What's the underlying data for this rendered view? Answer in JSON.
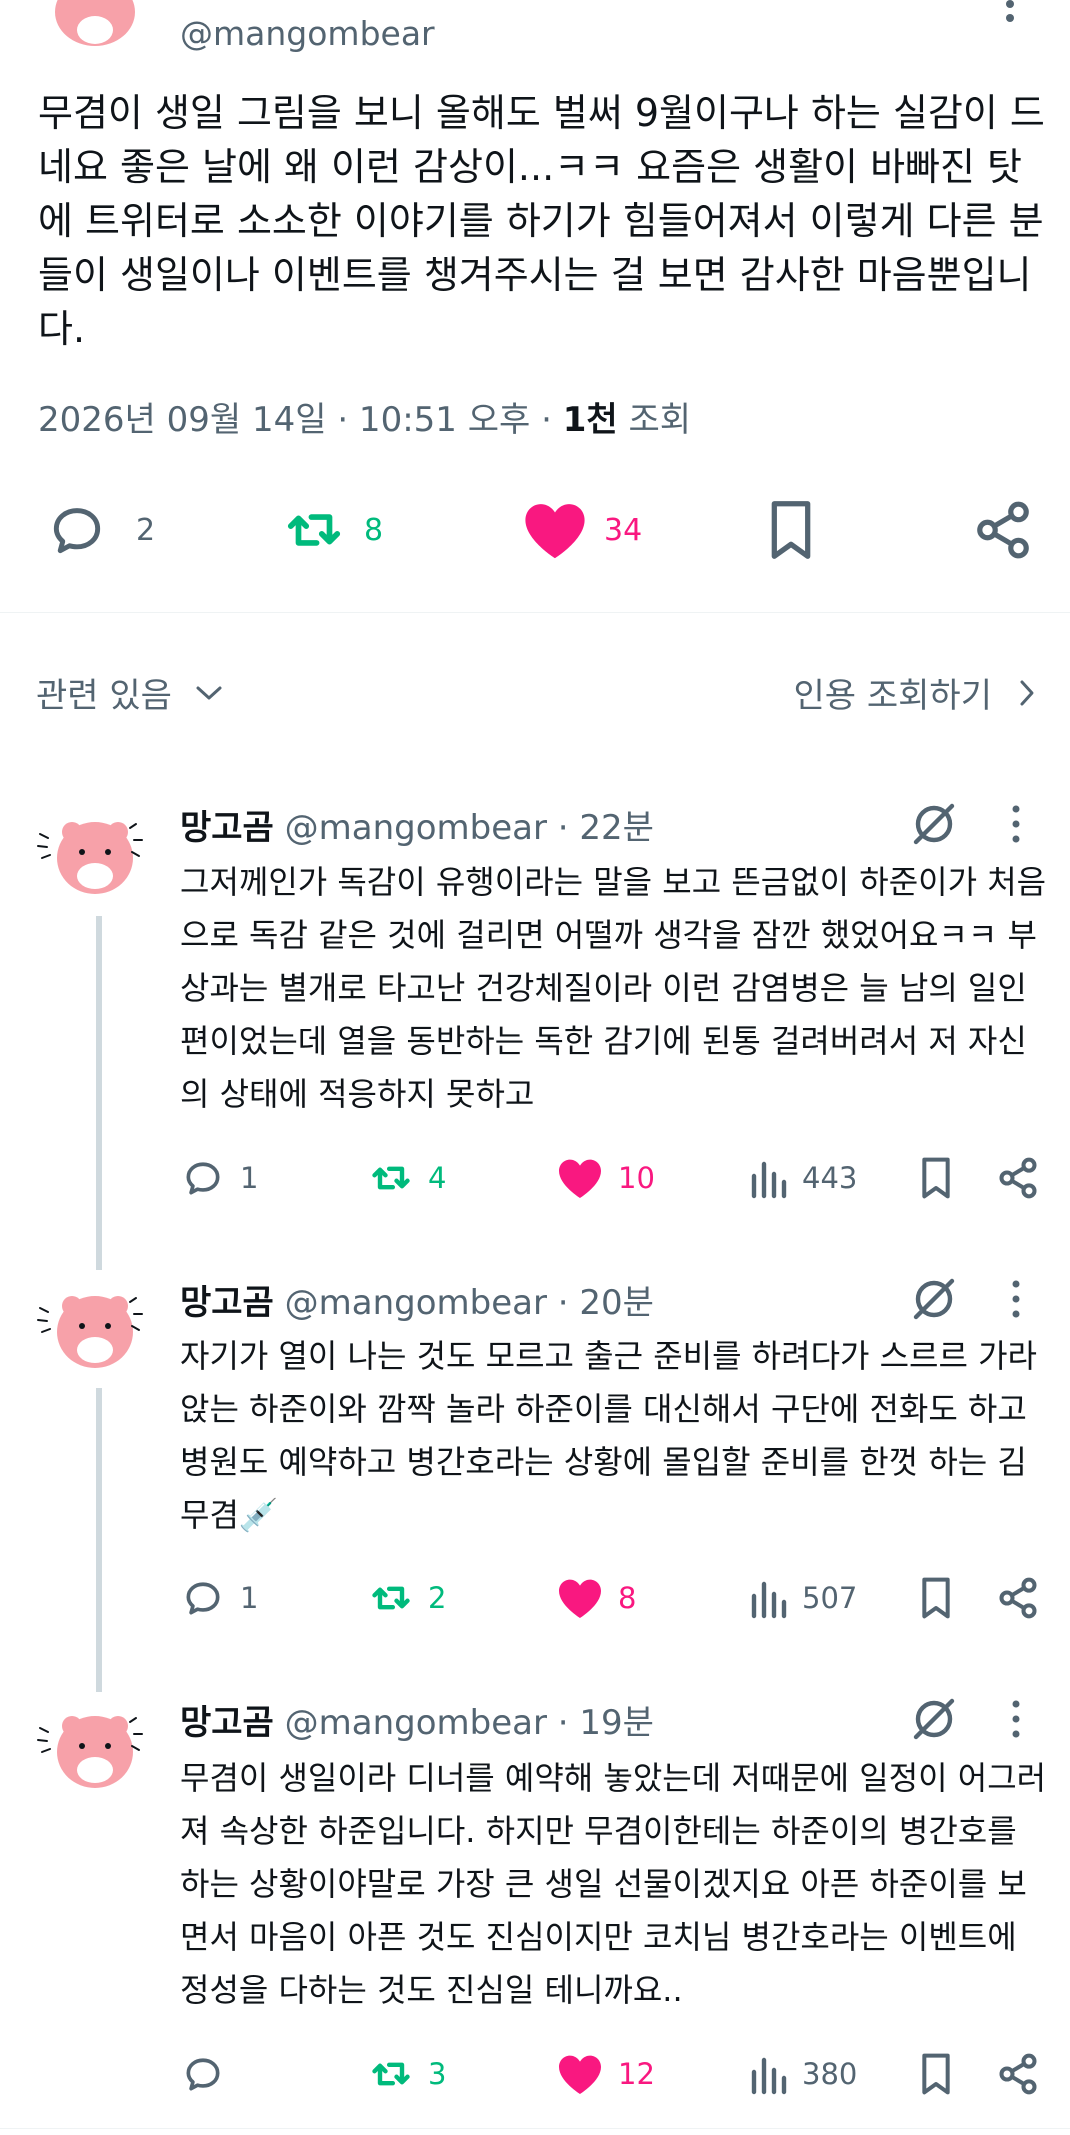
{
  "main": {
    "handle": "@mangombear",
    "text": "무겸이 생일 그림을 보니 올해도 벌써 9월이구나 하는 실감이 드네요 좋은 날에 왜 이런 감상이...ㅋㅋ 요즘은 생활이 바빠진 탓에 트위터로 소소한 이야기를 하기가 힘들어져서 이렇게 다른 분들이 생일이나 이벤트를 챙겨주시는 걸 보면 감사한 마음뿐입니다.",
    "date": "2026년 09월 14일 · 10:51 오후 · ",
    "views_count": "1천",
    "views_label": " 조회",
    "replies": "2",
    "retweets": "8",
    "likes": "34"
  },
  "related": {
    "label": "관련 있음",
    "quote_label": "인용 조회하기"
  },
  "replies": [
    {
      "name": "망고곰",
      "handle": "@mangombear",
      "time": " · 22분",
      "text": "그저께인가 독감이 유행이라는 말을 보고 뜬금없이 하준이가 처음으로 독감 같은 것에 걸리면 어떨까 생각을 잠깐 했었어요ㅋㅋ 부상과는 별개로 타고난 건강체질이라 이런 감염병은 늘 남의  일인 편이었는데 열을 동반하는 독한 감기에 된통 걸려버려서 저 자신의 상태에 적응하지 못하고",
      "replies": "1",
      "retweets": "4",
      "likes": "10",
      "views": "443"
    },
    {
      "name": "망고곰",
      "handle": "@mangombear",
      "time": " · 20분",
      "text": "자기가 열이 나는 것도 모르고 출근 준비를 하려다가 스르르 가라앉는 하준이와 깜짝 놀라 하준이를 대신해서 구단에 전화도 하고 병원도 예약하고 병간호라는 상황에 몰입할 준비를 한껏 하는 김무겸💉",
      "replies": "1",
      "retweets": "2",
      "likes": "8",
      "views": "507"
    },
    {
      "name": "망고곰",
      "handle": "@mangombear",
      "time": " · 19분",
      "text": "무겸이 생일이라 디너를 예약해 놓았는데 저때문에 일정이 어그러져 속상한 하준입니다. 하지만 무겸이한테는 하준이의 병간호를 하는 상황이야말로 가장 큰 생일 선물이겠지요 아픈 하준이를 보면서 마음이 아픈 것도 진심이지만 코치님 병간호라는 이벤트에 정성을 다하는 것도 진심일 테니까요..",
      "replies": "",
      "retweets": "3",
      "likes": "12",
      "views": "380"
    }
  ],
  "colors": {
    "text": "#0f1419",
    "secondary": "#536471",
    "retweet_green": "#00ba7c",
    "like_pink": "#f91880",
    "avatar_pink": "#f7a1a9"
  },
  "icons": [
    "avatar-bear-icon",
    "more-icon",
    "reply-icon",
    "retweet-icon",
    "heart-icon",
    "bookmark-icon",
    "share-icon",
    "views-icon",
    "grok-icon",
    "chevron-down-icon",
    "chevron-right-icon"
  ]
}
